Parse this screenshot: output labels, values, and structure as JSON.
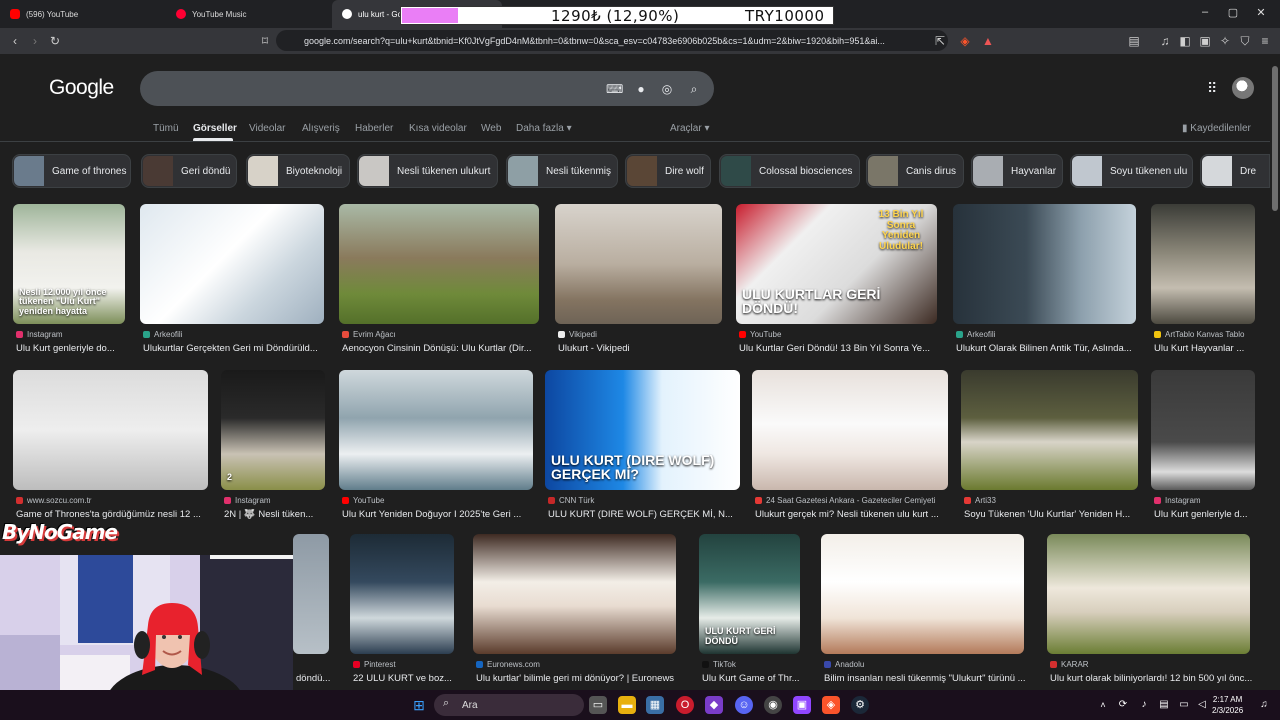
{
  "browser": {
    "tabs": [
      {
        "label": "(596) YouTube",
        "active": false
      },
      {
        "label": "YouTube Music",
        "active": false
      },
      {
        "label": "ulu kurt - Go",
        "active": true
      }
    ],
    "url": "google.com/search?q=ulu+kurt&tbnid=Kf0JtVgFgdD4nM&tbnh=0&tbnw=0&sca_esv=c04783e6906b025b&cs=1&udm=2&biw=1920&bih=951&ai..."
  },
  "donation": {
    "amount": "1290₺ (12,90%)",
    "goal": "TRY10000",
    "progress": 0.129,
    "fill_color": "#ea7ef6"
  },
  "google": {
    "logo": "Google",
    "search_query": "",
    "tabs": [
      "Tümü",
      "Görseller",
      "Videolar",
      "Alışveriş",
      "Haberler",
      "Kısa videolar",
      "Web",
      "Daha fazla ▾"
    ],
    "active_tab": "Görseller",
    "tools": "Araçlar ▾",
    "saved": "Kaydedilenler"
  },
  "chips": [
    {
      "label": "Game of thrones",
      "color": "#6a7b8c"
    },
    {
      "label": "Geri döndü",
      "color": "#4a3a34"
    },
    {
      "label": "Biyoteknoloji",
      "color": "#d7d2c8"
    },
    {
      "label": "Nesli tükenen ulukurt",
      "color": "#c9c7c4"
    },
    {
      "label": "Nesli tükenmiş",
      "color": "#8e9fa5"
    },
    {
      "label": "Dire wolf",
      "color": "#5a4636"
    },
    {
      "label": "Colossal biosciences",
      "color": "#2f4a48"
    },
    {
      "label": "Canis dirus",
      "color": "#7a7668"
    },
    {
      "label": "Hayvanlar",
      "color": "#a9adb2"
    },
    {
      "label": "Soyu tükenen ulu",
      "color": "#c0c7cf"
    },
    {
      "label": "Dre",
      "color": "#d5d8db"
    }
  ],
  "results": [
    {
      "source": "Instagram",
      "title": "Ulu Kurt genleriyle do...",
      "overlay": "Nesli 12.000 yıl önce tükenen \"Ulu Kurt\" yeniden hayatta",
      "src_color": "#e1306c",
      "img": "linear-gradient(180deg,#9fb59a 0%,#e9e9e3 40%,#f2f2ee 70%,#7d8f5a 100%)"
    },
    {
      "source": "Arkeofili",
      "title": "Ulukurtlar Gerçekten Geri mi Döndürüld...",
      "overlay": "",
      "src_color": "#2aa38a",
      "img": "linear-gradient(135deg,#dfe8ef 0%,#ffffff 45%,#cbd6de 70%,#9fb0bf 100%)"
    },
    {
      "source": "Evrim Ağacı",
      "title": "Aenocyon Cinsinin Dönüşü: Ulu Kurtlar (Dir...",
      "overlay": "",
      "src_color": "#e74c3c",
      "img": "linear-gradient(180deg,#a9b9a6 0%,#8a7a5c 45%,#6f8a3a 75%,#54702a 100%)"
    },
    {
      "source": "Vikipedi",
      "title": "Ulukurt - Vikipedi",
      "overlay": "",
      "src_color": "#eeeeee",
      "img": "linear-gradient(180deg,#d8d3cc 0%,#b9aea0 50%,#847461 80%,#6e6356 100%)"
    },
    {
      "source": "YouTube",
      "title": "Ulu Kurtlar Geri Döndü! 13 Bin Yıl Sonra Ye...",
      "overlay": "ULU KURTLAR GERİ DÖNDÜ!",
      "overlay2": "13 Bin Yıl Sonra Yeniden Uludular!",
      "src_color": "#ff0000",
      "img": "linear-gradient(135deg,#c81d2e 0%,#f0f0f0 30%,#dcdcdc 60%,#3c2a22 100%)"
    },
    {
      "source": "Arkeofili",
      "title": "Ulukurt Olarak Bilinen Antik Tür, Aslında...",
      "overlay": "",
      "src_color": "#2aa38a",
      "img": "linear-gradient(90deg,#27323b 0%,#3b4a55 40%,#8da0ad 70%,#c5d2db 100%)"
    },
    {
      "source": "ArtTablo Kanvas Tablo",
      "title": "Ulu Kurt Hayvanlar ...",
      "overlay": "",
      "src_color": "#f1c40f",
      "img": "linear-gradient(180deg,#3b3c37 0%,#8a8678 40%,#c4bdb0 70%,#4d4a40 100%)"
    },
    {
      "source": "www.sozcu.com.tr",
      "title": "Game of Thrones'ta gördüğümüz nesli 12 ...",
      "overlay": "",
      "src_color": "#d32f2f",
      "img": "linear-gradient(180deg,#dcdcdc 0%,#eeeeee 50%,#bdbdbd 100%)"
    },
    {
      "source": "Instagram",
      "title": "2N | 🐺 Nesli tüken...",
      "overlay": "2",
      "src_color": "#e1306c",
      "img": "linear-gradient(180deg,#1a1a1a 0%,#2a2a2a 40%,#c9c2b4 70%,#8a8f48 100%)"
    },
    {
      "source": "YouTube",
      "title": "Ulu Kurt Yeniden Doğuyor I 2025'te Geri ...",
      "overlay": "",
      "src_color": "#ff0000",
      "img": "linear-gradient(180deg,#cfd8dc 0%,#90a4ae 40%,#eceff1 70%,#607d8b 100%)"
    },
    {
      "source": "CNN Türk",
      "title": "ULU KURT (DIRE WOLF) GERÇEK Mİ, N...",
      "overlay": "ULU KURT (DIRE WOLF) GERÇEK Mİ?",
      "src_color": "#c62828",
      "img": "linear-gradient(90deg,#0d47a1 0%,#1e88e5 40%,#e3f2fd 60%,#ffffff 100%)"
    },
    {
      "source": "24 Saat Gazetesi Ankara - Gazeteciler Cemiyeti",
      "title": "Ulukurt gerçek mi? Nesli tükenen ulu kurt ...",
      "overlay": "",
      "src_color": "#e53935",
      "img": "linear-gradient(180deg,#e8e1dc 0%,#fafafa 45%,#efe7e2 70%,#c9b7ad 100%)"
    },
    {
      "source": "Arti33",
      "title": "Soyu Tükenen 'Ulu Kurtlar' Yeniden H...",
      "overlay": "",
      "src_color": "#e53935",
      "img": "linear-gradient(180deg,#3a3b2e 0%,#5d5f3f 40%,#d8d4c8 60%,#6b7a2f 100%)"
    },
    {
      "source": "Instagram",
      "title": "Ulu Kurt genleriyle d...",
      "overlay": "",
      "src_color": "#e1306c",
      "img": "linear-gradient(180deg,#3a3a3a 0%,#4a4a4a 60%,#dcdcdc 85%,#5a5a5a 100%)"
    },
    {
      "source": "",
      "title": "döndü...",
      "overlay": "",
      "src_color": "#999",
      "img": "linear-gradient(180deg,#8e9aa5 0%,#b7c0c7 100%)"
    },
    {
      "source": "Pinterest",
      "title": "22 ULU KURT ve boz...",
      "overlay": "",
      "src_color": "#e60023",
      "img": "linear-gradient(180deg,#1d2b36 0%,#34495e 40%,#cfd8dc 70%,#2c3e50 100%)"
    },
    {
      "source": "Euronews.com",
      "title": "Ulu kurtlar' bilimle geri mi dönüyor? | Euronews",
      "overlay": "",
      "src_color": "#1565c0",
      "img": "linear-gradient(180deg,#3e2a22 0%,#f3eee7 40%,#e8dcd1 60%,#5b3c2c 100%)"
    },
    {
      "source": "TikTok",
      "title": "Ulu Kurt Game of Thr...",
      "overlay": "ULU KURT GERİ DÖNDÜ",
      "src_color": "#111111",
      "img": "linear-gradient(180deg,#23433f 0%,#3b6b64 40%,#e6ece8 70%,#1f3532 100%)"
    },
    {
      "source": "Anadolu",
      "title": "Bilim insanları nesli tükenmiş \"Ulukurt\" türünü ...",
      "overlay": "",
      "src_color": "#3949ab",
      "img": "linear-gradient(180deg,#f3efe9 0%,#ffffff 40%,#f0e4d8 70%,#b37a5a 100%)"
    },
    {
      "source": "KARAR",
      "title": "Ulu kurt olarak biliniyorlardı! 12 bin 500 yıl önc...",
      "overlay": "",
      "src_color": "#d32f2f",
      "img": "linear-gradient(180deg,#7a8a5a 0%,#eee8dc 45%,#d8cfbd 65%,#6b7e34 100%)"
    }
  ],
  "stream": {
    "brand": "ByNoGame"
  },
  "taskbar": {
    "search_placeholder": "Ara",
    "time": "2:17 AM",
    "date": "2/3/2026"
  }
}
